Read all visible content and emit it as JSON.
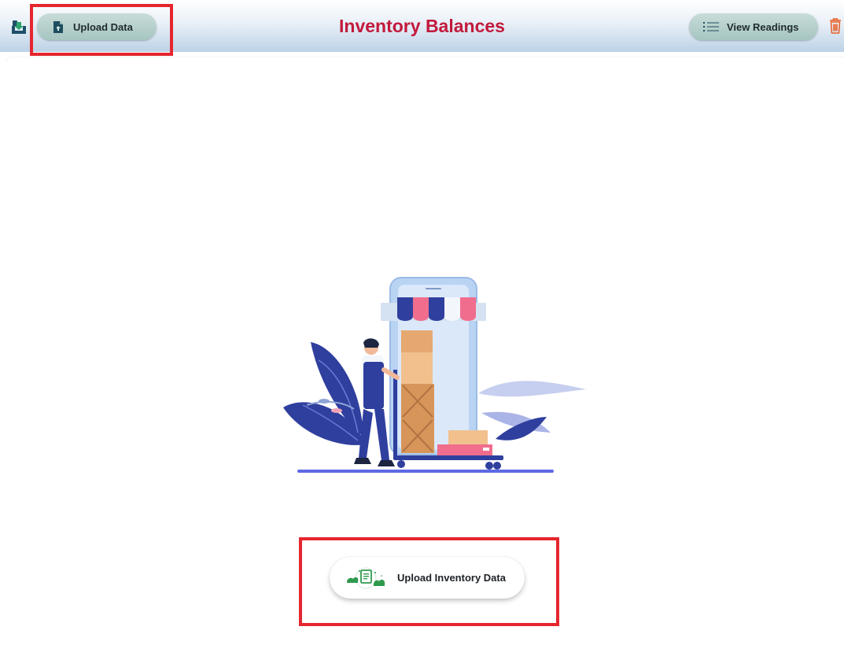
{
  "header": {
    "title": "Inventory Balances",
    "title_color": "#c21a3c",
    "app_icon": "download-tray-icon",
    "upload_button_label": "Upload Data",
    "upload_button_icon": "file-upload-icon",
    "view_readings_label": "View Readings",
    "view_readings_icon": "list-icon",
    "delete_icon": "trash-icon",
    "delete_icon_color": "#e8622c"
  },
  "main": {
    "illustration": "inventory-illustration",
    "upload_inventory_label": "Upload Inventory Data",
    "upload_inventory_icon": "cloud-documents-icon"
  },
  "highlight_color": "#e5262f"
}
